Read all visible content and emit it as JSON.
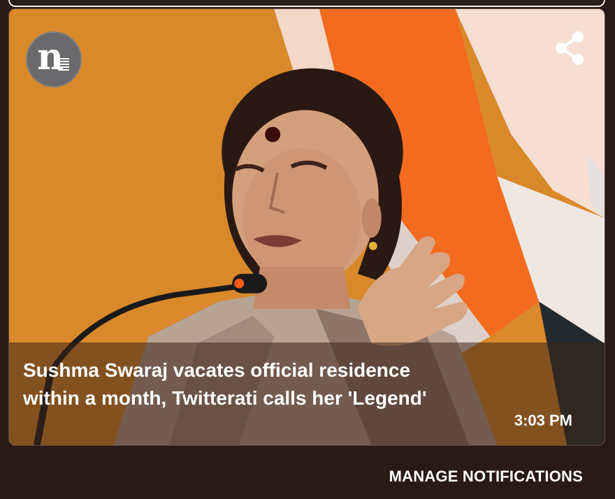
{
  "notification": {
    "headline": "Sushma Swaraj vacates official residence within a month, Twitterati calls her 'Legend'",
    "time": "3:03 PM",
    "app_icon": "n-news-logo-icon",
    "share_icon": "share-icon",
    "accent_colors": {
      "background_orange": "#d9892a",
      "flag_saffron": "#f26b1f",
      "caption_overlay": "#3c2218"
    }
  },
  "footer": {
    "manage_label": "MANAGE NOTIFICATIONS"
  }
}
